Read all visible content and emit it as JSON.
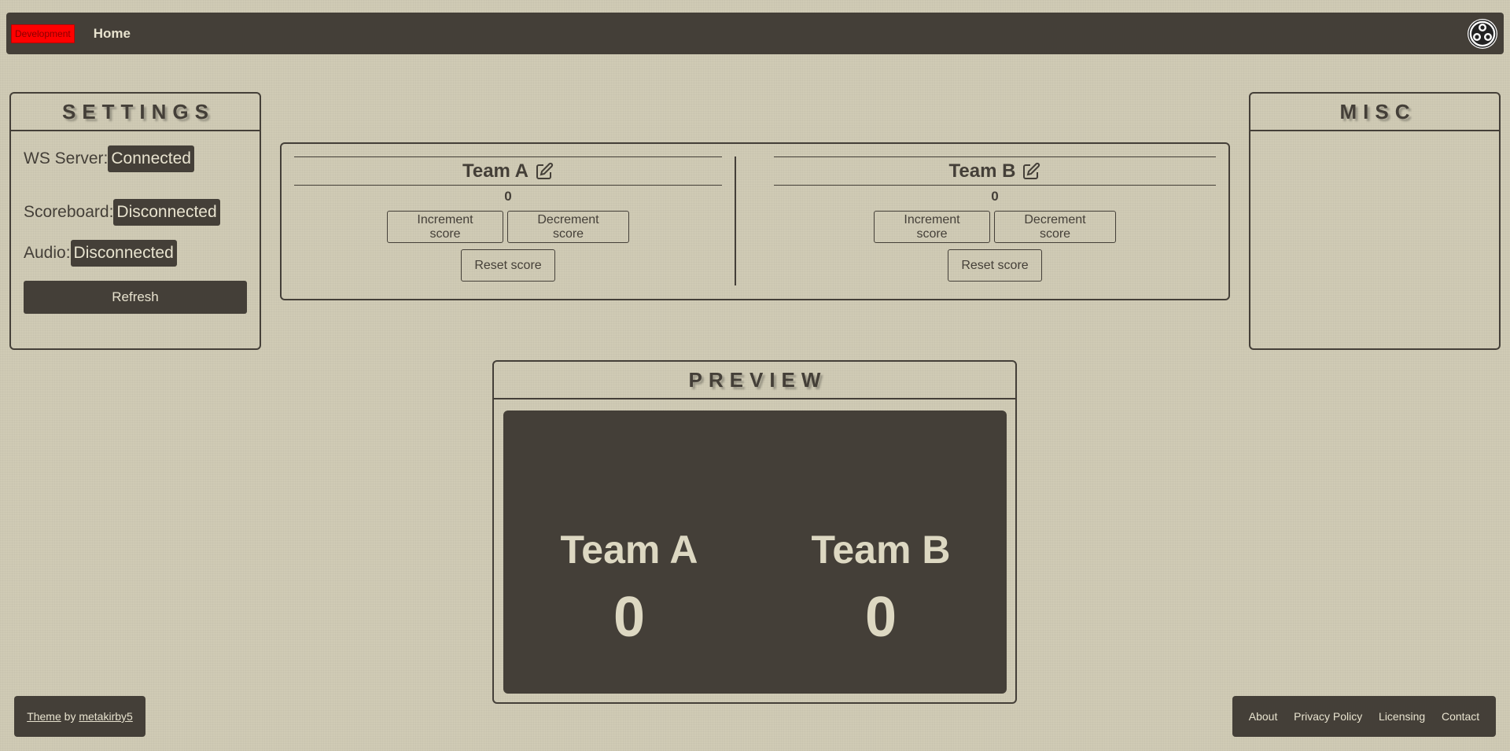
{
  "nav": {
    "env_badge": "Development",
    "home": "Home",
    "logo_icon": "obs-logo-icon"
  },
  "settings": {
    "title": "SETTINGS",
    "ws_label": "WS Server:",
    "ws_status": "Connected",
    "scoreboard_label": "Scoreboard:",
    "scoreboard_status": "Disconnected",
    "audio_label": "Audio:",
    "audio_status": "Disconnected",
    "refresh": "Refresh"
  },
  "misc": {
    "title": "MISC"
  },
  "teams": [
    {
      "name": "Team A",
      "score": "0",
      "increment": "Increment score",
      "decrement": "Decrement score",
      "reset": "Reset score",
      "edit_icon": "edit-icon"
    },
    {
      "name": "Team B",
      "score": "0",
      "increment": "Increment score",
      "decrement": "Decrement score",
      "reset": "Reset score",
      "edit_icon": "edit-icon"
    }
  ],
  "preview": {
    "title": "PREVIEW",
    "team_a_name": "Team A",
    "team_a_score": "0",
    "team_b_name": "Team B",
    "team_b_score": "0"
  },
  "footer": {
    "theme": "Theme",
    "by": " by ",
    "author": "metakirby5",
    "links": [
      "About",
      "Privacy Policy",
      "Licensing",
      "Contact"
    ]
  },
  "colors": {
    "background": "#d0cbb5",
    "dark": "#443f38",
    "light_text": "#e8e3cf",
    "env_badge": "#ff0000"
  }
}
